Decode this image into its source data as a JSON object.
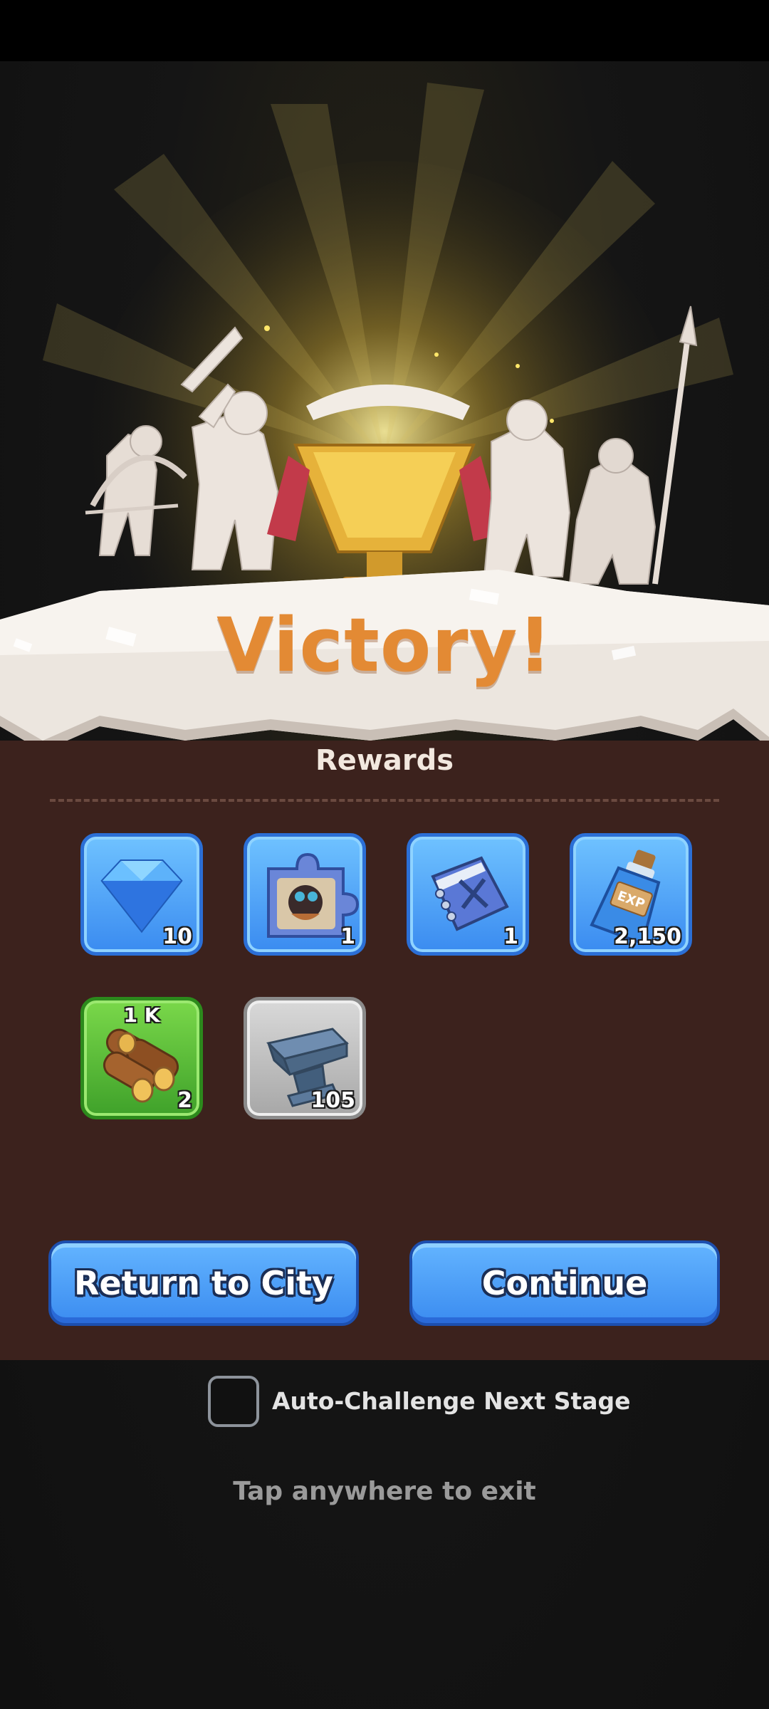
{
  "victory": {
    "title": "Victory!"
  },
  "rewards": {
    "title": "Rewards",
    "items": [
      {
        "icon": "diamond-gem-icon",
        "quantity": "10"
      },
      {
        "icon": "hero-puzzle-piece-icon",
        "quantity": "1"
      },
      {
        "icon": "skill-book-icon",
        "quantity": "1"
      },
      {
        "icon": "exp-potion-icon",
        "quantity": "2,150"
      },
      {
        "icon": "wood-logs-icon",
        "tag": "1 K",
        "quantity": "2"
      },
      {
        "icon": "iron-anvil-icon",
        "quantity": "105"
      }
    ]
  },
  "buttons": {
    "return_city": "Return to City",
    "continue": "Continue"
  },
  "auto_challenge": {
    "label": "Auto-Challenge Next Stage",
    "checked": false
  },
  "exit_hint": "Tap anywhere to exit",
  "colors": {
    "panel": "#3c221d",
    "victory_text": "#e38a34",
    "button_blue": "#4a9df5",
    "tile_blue": "#4d9ff5",
    "tile_green": "#4fb535",
    "tile_gray": "#bdbdbd"
  }
}
